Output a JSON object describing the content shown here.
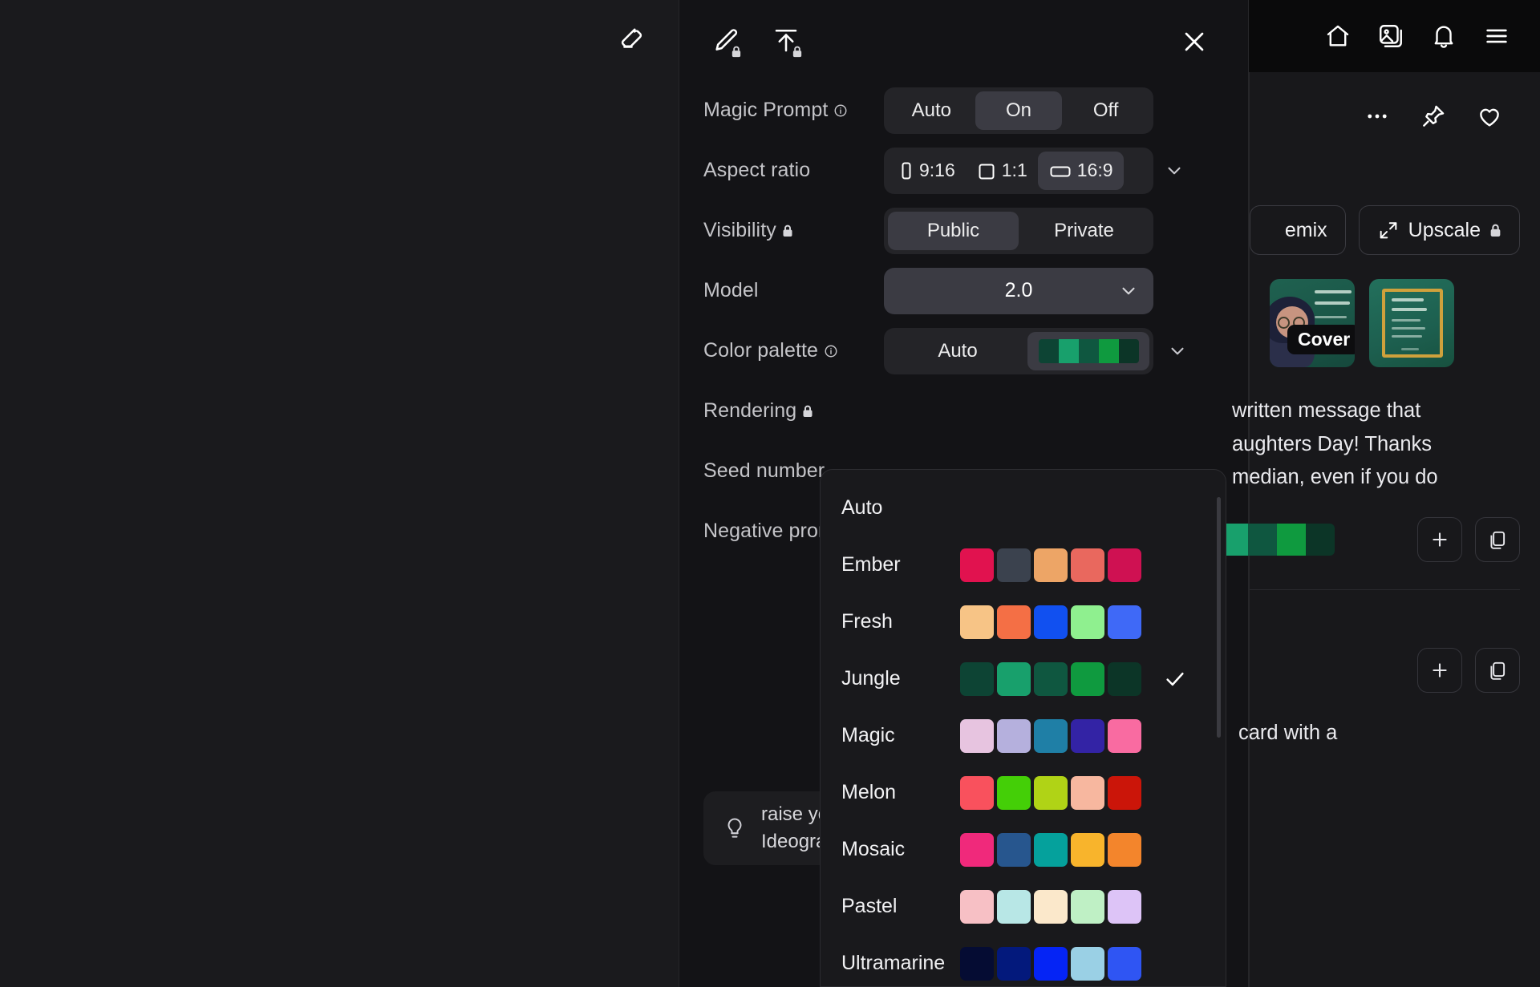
{
  "left_toolbar": {
    "eraser_icon": "eraser-icon"
  },
  "panel_header": {
    "edit_icon": "pencil-edit-icon",
    "upload_icon": "upload-icon",
    "close_icon": "close-icon",
    "edit_locked": true,
    "upload_locked": true
  },
  "settings": {
    "rows": [
      {
        "id": "magic-prompt",
        "label": "Magic Prompt",
        "has_info": true,
        "locked": false,
        "type": "segmented",
        "options": [
          "Auto",
          "On",
          "Off"
        ],
        "selected": "On"
      },
      {
        "id": "aspect-ratio",
        "label": "Aspect ratio",
        "has_info": false,
        "locked": false,
        "type": "segmented-icons",
        "options": [
          "9:16",
          "1:1",
          "16:9"
        ],
        "selected": "16:9",
        "has_chevron": true
      },
      {
        "id": "visibility",
        "label": "Visibility",
        "has_info": false,
        "locked": true,
        "type": "segmented",
        "options": [
          "Public",
          "Private"
        ],
        "selected": "Public"
      },
      {
        "id": "model",
        "label": "Model",
        "has_info": false,
        "locked": false,
        "type": "select",
        "value": "2.0"
      },
      {
        "id": "color-palette",
        "label": "Color palette",
        "has_info": true,
        "locked": false,
        "type": "palette",
        "value": "Auto",
        "preview_swatches": [
          "#0d4434",
          "#18a06c",
          "#0f5740",
          "#0f9a3f",
          "#0c3527"
        ],
        "has_chevron": true
      },
      {
        "id": "rendering",
        "label": "Rendering",
        "has_info": false,
        "locked": true,
        "type": "hidden-control"
      },
      {
        "id": "seed-number",
        "label": "Seed number",
        "has_info": false,
        "locked": false,
        "type": "hidden-control"
      },
      {
        "id": "negative-prompt",
        "label": "Negative prompt",
        "has_info": false,
        "locked": false,
        "type": "hidden-control"
      }
    ]
  },
  "tip": {
    "icon": "lightbulb-icon",
    "line1": "raise yo",
    "line2": "Ideogra"
  },
  "palette_dropdown": {
    "items": [
      {
        "name": "Auto",
        "swatches": [],
        "selected": false
      },
      {
        "name": "Ember",
        "swatches": [
          "#e1124f",
          "#3b424e",
          "#eda566",
          "#e9685e",
          "#cf1152"
        ],
        "selected": false
      },
      {
        "name": "Fresh",
        "swatches": [
          "#f7c486",
          "#f46f45",
          "#1150f0",
          "#8ff08f",
          "#3f69f7"
        ],
        "selected": false
      },
      {
        "name": "Jungle",
        "swatches": [
          "#0d4434",
          "#18a06c",
          "#0f5740",
          "#0f9a3f",
          "#0c3527"
        ],
        "selected": true
      },
      {
        "name": "Magic",
        "swatches": [
          "#e7c4e0",
          "#b5b0dd",
          "#1f7fa6",
          "#3323a5",
          "#f96ba1"
        ],
        "selected": false
      },
      {
        "name": "Melon",
        "swatches": [
          "#f9515d",
          "#44cf07",
          "#b0d316",
          "#f7b79f",
          "#cb1509"
        ],
        "selected": false
      },
      {
        "name": "Mosaic",
        "swatches": [
          "#f0297b",
          "#27568e",
          "#05a19c",
          "#f8b42c",
          "#f3852c"
        ],
        "selected": false
      },
      {
        "name": "Pastel",
        "swatches": [
          "#f7c0c5",
          "#b8e7e6",
          "#fbe8cb",
          "#bff0c5",
          "#ddc4f7"
        ],
        "selected": false
      },
      {
        "name": "Ultramarine",
        "swatches": [
          "#050c33",
          "#03197c",
          "#0524f5",
          "#9ad0e5",
          "#2f55f3"
        ],
        "selected": false
      }
    ],
    "check_icon": "checkmark-icon"
  },
  "topbar": {
    "icons": [
      {
        "name": "home-icon"
      },
      {
        "name": "gallery-icon"
      },
      {
        "name": "bell-icon"
      },
      {
        "name": "menu-icon"
      }
    ]
  },
  "detail_card": {
    "actions": [
      {
        "name": "more-options-icon"
      },
      {
        "name": "pin-icon"
      },
      {
        "name": "heart-icon"
      }
    ],
    "buttons": [
      {
        "id": "remix",
        "label": "emix",
        "icon": null,
        "locked": false
      },
      {
        "id": "upscale",
        "label": "Upscale",
        "icon": "upscale-icon",
        "locked": true
      }
    ],
    "thumbnails": [
      {
        "id": "thumb-cover",
        "badge": "Cover"
      },
      {
        "id": "thumb-second",
        "badge": ""
      }
    ],
    "prompt_lines": [
      "written message that",
      "aughters Day! Thanks",
      "median, even if you do"
    ],
    "tail_text": "card with a",
    "swatch_strip": [
      "#18a06c",
      "#0f5740",
      "#0f9a3f",
      "#0c3527"
    ],
    "mini_buttons": [
      {
        "name": "add-icon",
        "label": "+"
      },
      {
        "name": "copy-icon",
        "label": ""
      }
    ]
  }
}
